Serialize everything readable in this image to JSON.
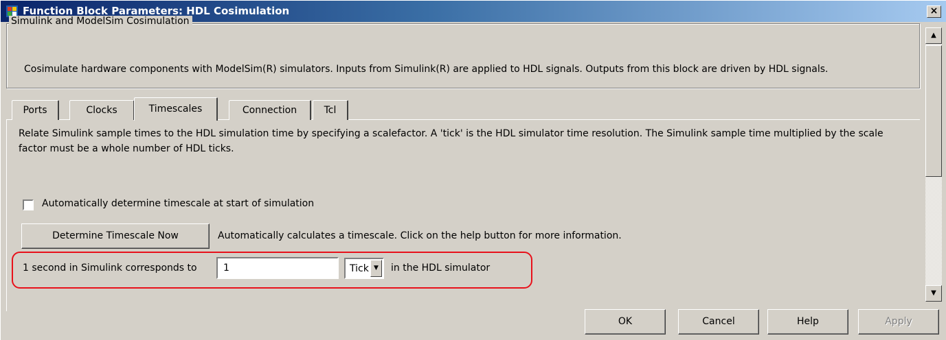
{
  "window": {
    "title": "Function Block Parameters: HDL Cosimulation",
    "close_label": "×"
  },
  "group": {
    "legend": "Simulink and ModelSim Cosimulation",
    "description": "Cosimulate hardware components with ModelSim(R) simulators. Inputs from Simulink(R) are applied to HDL signals. Outputs from this block are driven by HDL signals."
  },
  "tabs": [
    {
      "label": "Ports"
    },
    {
      "label": "Clocks"
    },
    {
      "label": "Timescales",
      "active": true
    },
    {
      "label": "Connection"
    },
    {
      "label": "Tcl"
    }
  ],
  "timescales": {
    "description": "Relate Simulink sample times to the HDL simulation time by specifying a scalefactor. A 'tick' is the HDL simulator time resolution. The Simulink sample time multiplied by the scale factor must be a whole number of HDL ticks.",
    "auto_checkbox_label": "Automatically determine timescale at start of simulation",
    "auto_checkbox_checked": false,
    "determine_button_label": "Determine Timescale Now",
    "determine_note": "Automatically calculates a timescale. Click on the help button for more information.",
    "correspondence_prefix": "1 second in Simulink corresponds to",
    "correspondence_value": "1",
    "unit_selected": "Tick",
    "correspondence_suffix": "in the HDL simulator",
    "highlight_color": "#e8101a"
  },
  "buttons": {
    "ok": "OK",
    "cancel": "Cancel",
    "help": "Help",
    "apply": "Apply"
  },
  "icons": {
    "app": "matlab-block-icon",
    "close": "close-icon",
    "scroll_up": "arrow-up-icon",
    "scroll_down": "arrow-down-icon",
    "dropdown": "chevron-down-icon"
  }
}
